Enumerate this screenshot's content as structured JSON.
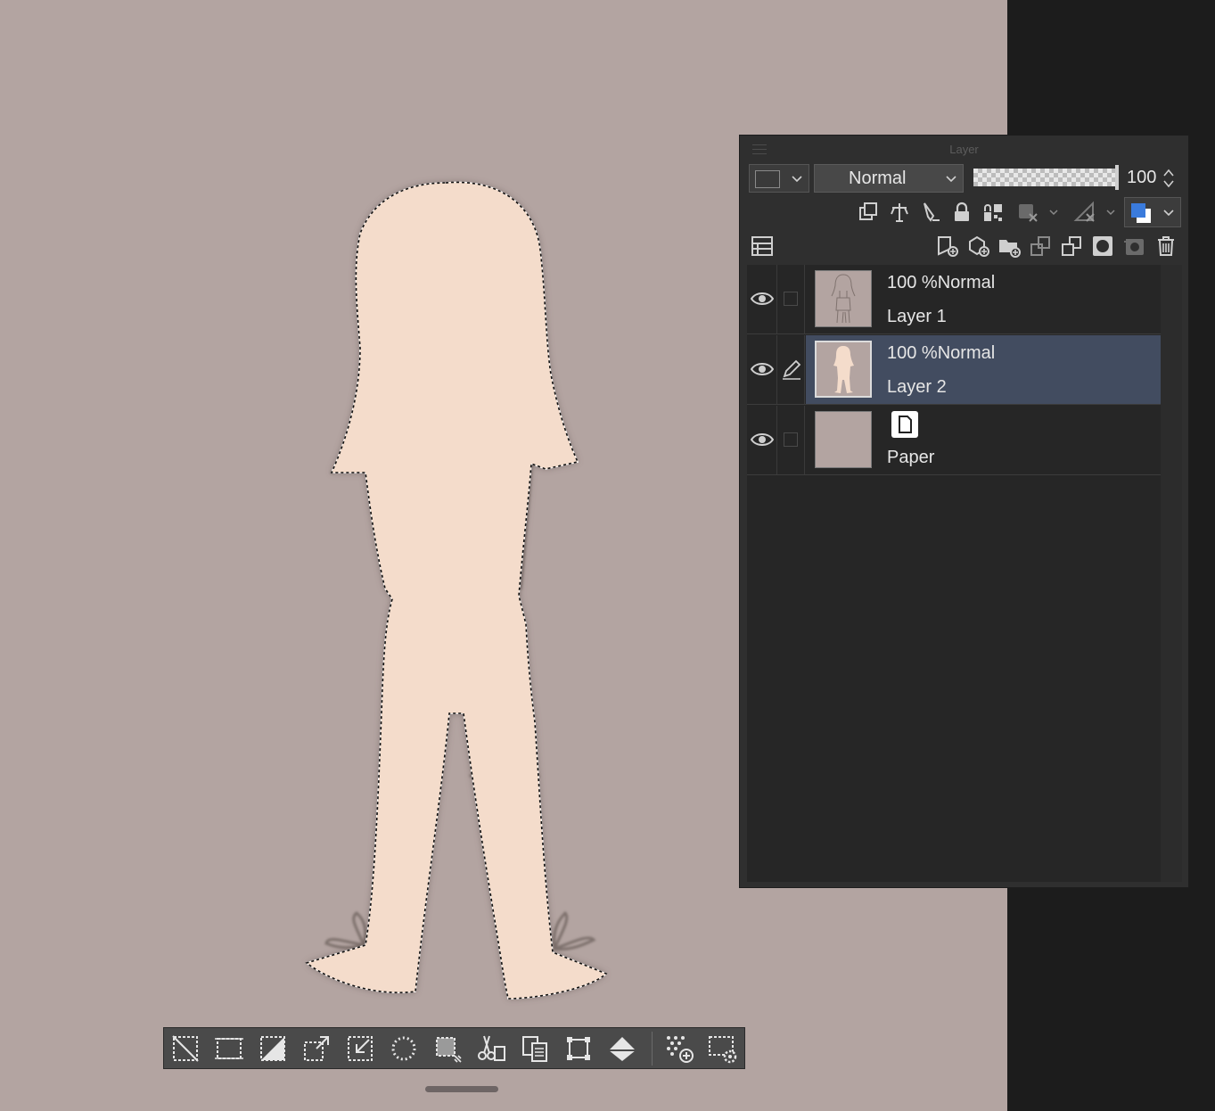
{
  "layer_panel": {
    "title": "Layer",
    "blend_mode": "Normal",
    "opacity_value": "100",
    "active_color": "#3a7bdc"
  },
  "layers": [
    {
      "opacity": "100 %",
      "mode": "Normal",
      "name": "Layer 1",
      "selected": false
    },
    {
      "opacity": "100 %",
      "mode": "Normal",
      "name": "Layer 2",
      "selected": true
    },
    {
      "name": "Paper",
      "selected": false
    }
  ],
  "canvas": {
    "background": "#b3a4a1",
    "figure_fill": "#f4dccb",
    "line_color": "#6b5e5a"
  },
  "selection_toolbar": {
    "buttons": [
      "deselect-icon",
      "select-all-icon",
      "invert-selection-icon",
      "expand-selection-icon",
      "shrink-selection-icon",
      "smooth-selection-icon",
      "selection-border-icon",
      "cut-paste-icon",
      "copy-paste-icon",
      "transform-icon",
      "fill-icon",
      "convert-to-selection-layer-icon",
      "selection-settings-icon"
    ]
  }
}
